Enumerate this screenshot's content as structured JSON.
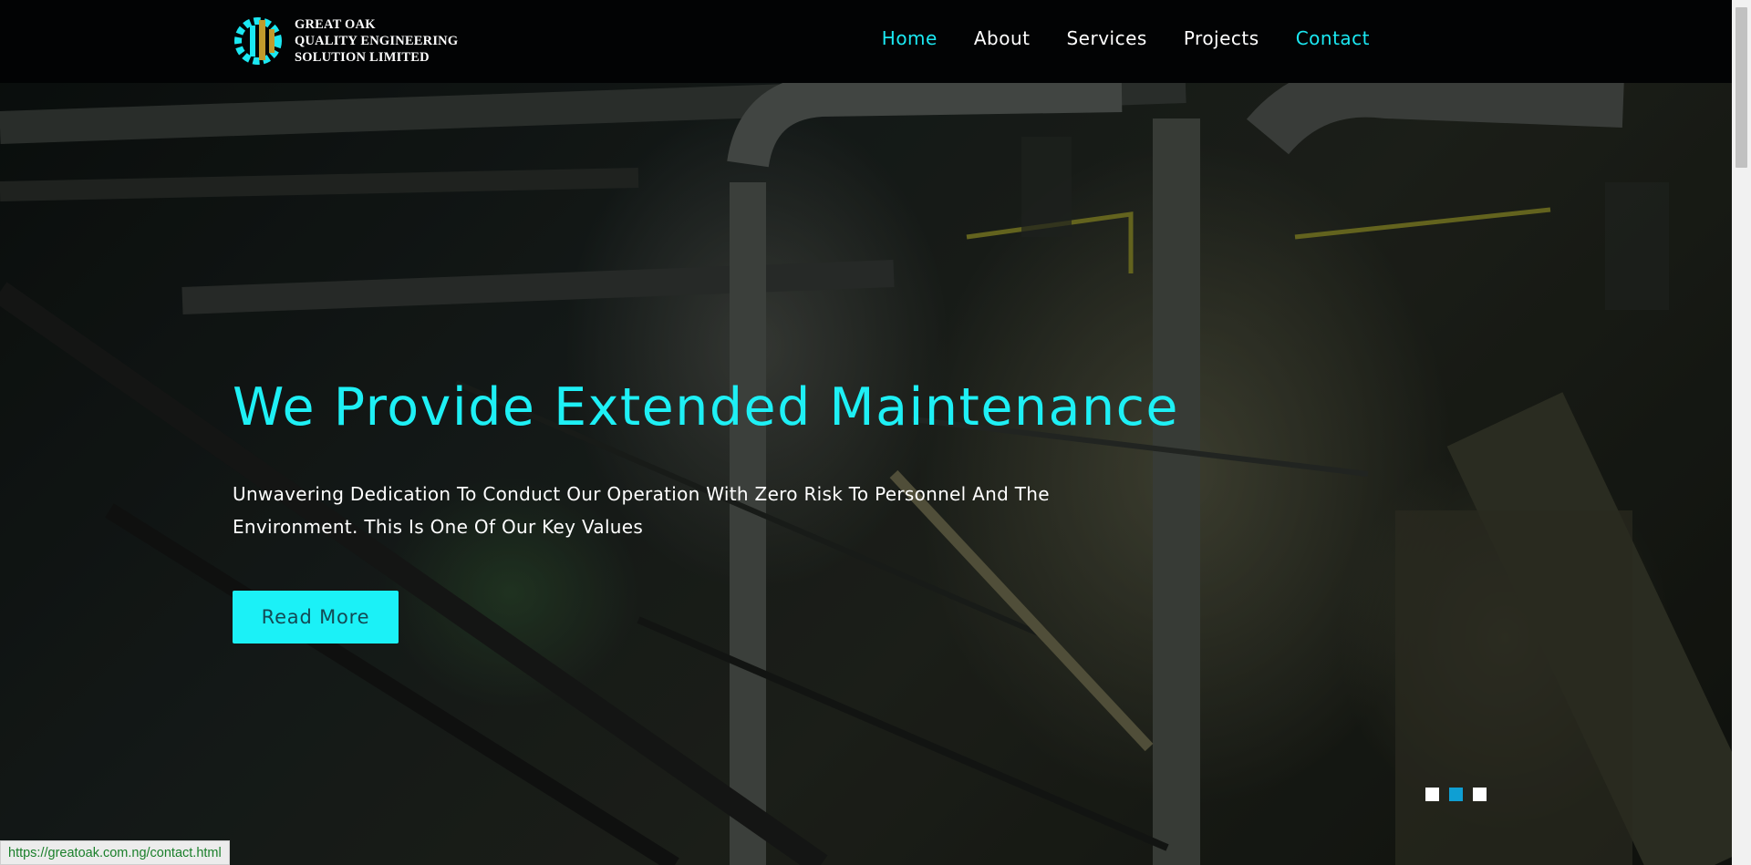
{
  "brand": {
    "line1": "GREAT OAK",
    "line2": "QUALITY ENGINEERING",
    "line3": "SOLUTION LIMITED"
  },
  "nav": {
    "items": [
      {
        "label": "Home",
        "state": "active"
      },
      {
        "label": "About",
        "state": "normal"
      },
      {
        "label": "Services",
        "state": "normal"
      },
      {
        "label": "Projects",
        "state": "normal"
      },
      {
        "label": "Contact",
        "state": "hovered"
      }
    ]
  },
  "hero": {
    "headline": "We Provide Extended Maintenance",
    "subtext": "Unwavering Dedication To Conduct Our Operation With Zero Risk To Personnel And The Environment. This Is One Of Our Key Values",
    "button_label": "Read More"
  },
  "slider": {
    "total": 3,
    "active_index": 2
  },
  "status_bar": {
    "url": "https://greatoak.com.ng/contact.html"
  },
  "colors": {
    "accent": "#1ef0f5",
    "button": "#1bf1f7",
    "active_dot": "#0f9fd3",
    "navbar": "#020304"
  }
}
